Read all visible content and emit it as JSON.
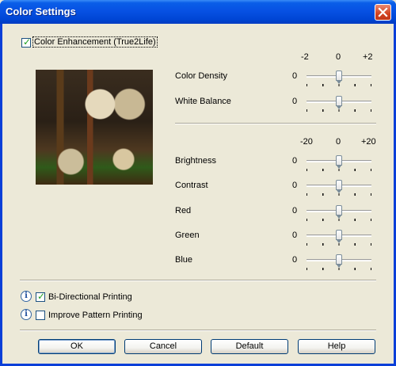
{
  "window": {
    "title": "Color Settings",
    "close_icon": "close-icon"
  },
  "color_enhancement": {
    "label": "Color Enhancement (True2Life)",
    "checked": true
  },
  "scale_small": {
    "min": "-2",
    "mid": "0",
    "max": "+2"
  },
  "scale_large": {
    "min": "-20",
    "mid": "0",
    "max": "+20"
  },
  "sliders_top": [
    {
      "label": "Color Density",
      "value": "0"
    },
    {
      "label": "White Balance",
      "value": "0"
    }
  ],
  "sliders_bottom": [
    {
      "label": "Brightness",
      "value": "0"
    },
    {
      "label": "Contrast",
      "value": "0"
    },
    {
      "label": "Red",
      "value": "0"
    },
    {
      "label": "Green",
      "value": "0"
    },
    {
      "label": "Blue",
      "value": "0"
    }
  ],
  "options": {
    "bidirectional": {
      "label": "Bi-Directional Printing",
      "checked": true
    },
    "improve_pattern": {
      "label": "Improve Pattern Printing",
      "checked": false
    }
  },
  "buttons": {
    "ok": "OK",
    "cancel": "Cancel",
    "default": "Default",
    "help": "Help"
  }
}
